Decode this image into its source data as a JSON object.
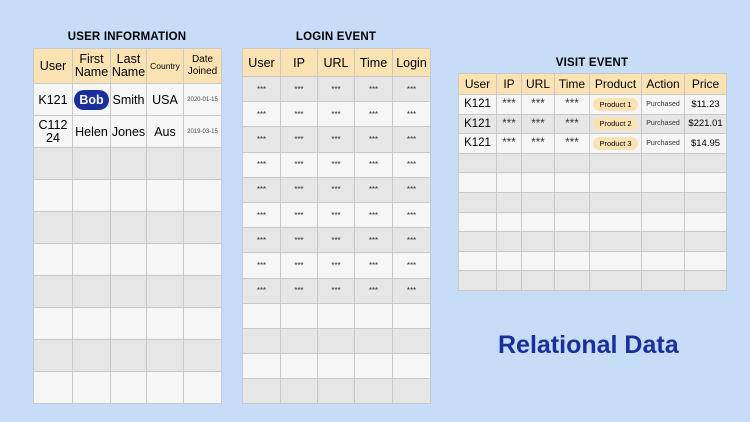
{
  "user_info": {
    "title": "USER INFORMATION",
    "headers": [
      "User",
      "First Name",
      "Last Name",
      "Country",
      "Date Joined"
    ],
    "rows": [
      [
        "K121",
        "Bob",
        "Smith",
        "USA",
        "2020-01-15"
      ],
      [
        "C112 24",
        "Helen",
        "Jones",
        "Aus",
        "2019-03-15"
      ]
    ]
  },
  "login_event": {
    "title": "LOGIN EVENT",
    "headers": [
      "User",
      "IP",
      "URL",
      "Time",
      "Login"
    ],
    "masked": "***"
  },
  "visit_event": {
    "title": "VISIT EVENT",
    "headers": [
      "User",
      "IP",
      "URL",
      "Time",
      "Product",
      "Action",
      "Price"
    ],
    "masked": "***",
    "rows": [
      {
        "user": "K121",
        "product": "Product 1",
        "action": "Purchased",
        "price": "$11.23"
      },
      {
        "user": "K121",
        "product": "Product 2",
        "action": "Purchased",
        "price": "$221.01"
      },
      {
        "user": "K121",
        "product": "Product 3",
        "action": "Purchased",
        "price": "$14.95"
      }
    ]
  },
  "heading": "Relational Data",
  "colors": {
    "background": "#c6dcf7",
    "header": "#fbe2b3",
    "accent": "#1a2e9e"
  }
}
